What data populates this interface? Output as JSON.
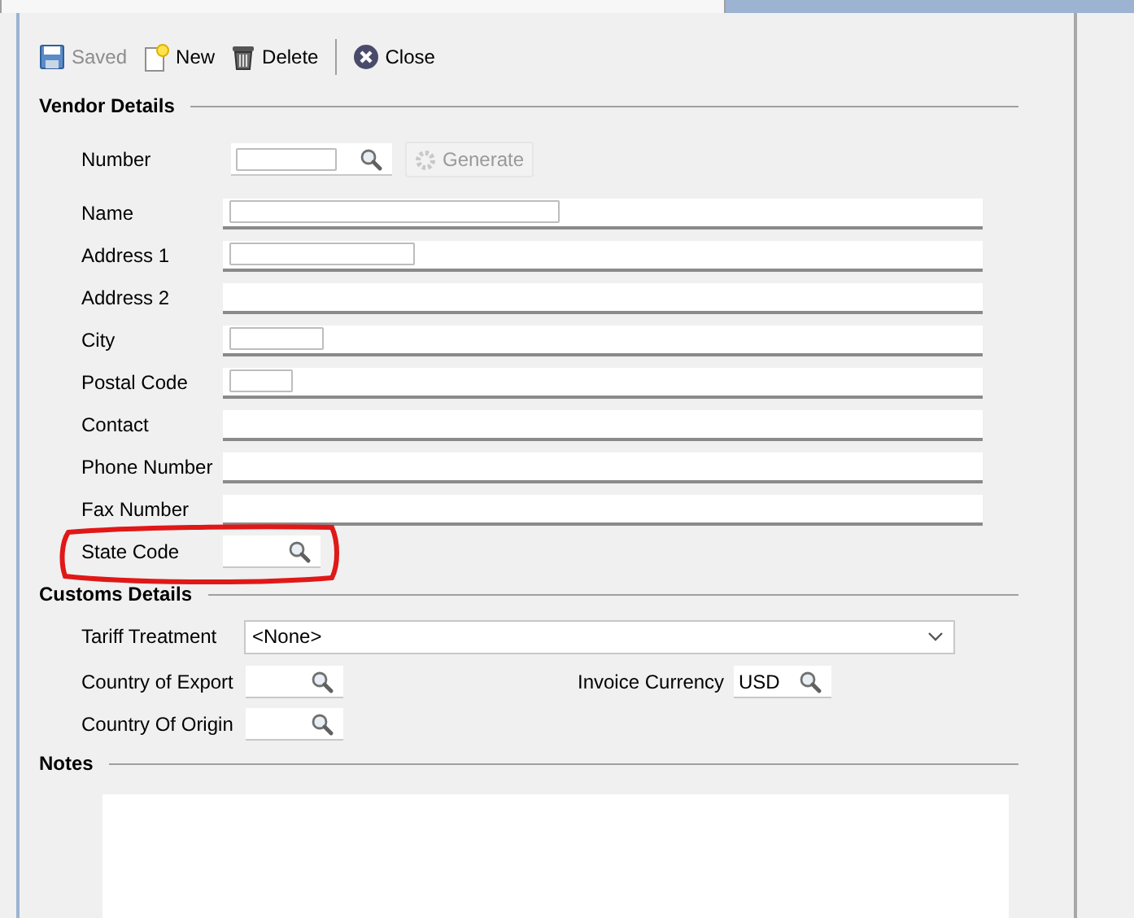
{
  "toolbar": [
    {
      "label": "Saved",
      "kind": "save",
      "disabled": true
    },
    {
      "label": "New",
      "kind": "new",
      "disabled": false
    },
    {
      "label": "Delete",
      "kind": "delete",
      "disabled": false
    },
    {
      "label": "Close",
      "kind": "close",
      "disabled": false
    }
  ],
  "vendor_details": {
    "title": "Vendor Details",
    "number": {
      "label": "Number",
      "generate": {
        "label": "Generate",
        "disabled": true
      }
    },
    "fields": [
      {
        "label": "Name",
        "level": 0.43
      },
      {
        "label": "Address 1",
        "level": 0.24
      },
      {
        "label": "Address 2"
      },
      {
        "label": "City",
        "level": 0.12
      },
      {
        "label": "Postal Code",
        "level": 0.08
      },
      {
        "label": "Contact"
      },
      {
        "label": "Phone Number"
      },
      {
        "label": "Fax Number"
      }
    ],
    "state_code": {
      "label": "State Code",
      "highlighted": true
    }
  },
  "customs_details": {
    "title": "Customs Details",
    "tariff_treatment": {
      "label": "Tariff Treatment",
      "value": "<None>"
    },
    "country_of_export": {
      "label": "Country of Export"
    },
    "invoice_currency": {
      "label": "Invoice Currency",
      "value": "USD"
    },
    "country_of_origin": {
      "label": "Country Of Origin"
    }
  },
  "notes": {
    "title": "Notes"
  }
}
